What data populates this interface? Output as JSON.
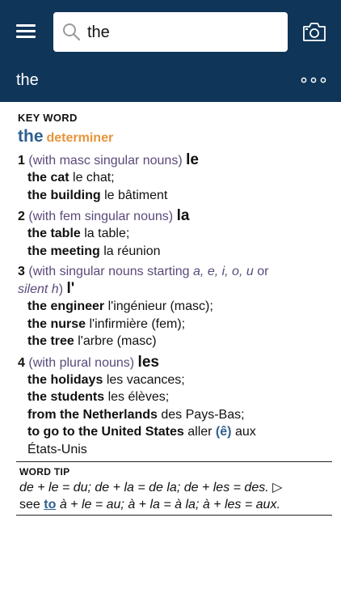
{
  "search": {
    "value": "the"
  },
  "headword_bar": {
    "title": "the"
  },
  "entry": {
    "label": "KEY WORD",
    "headword": "the",
    "pos": "determiner",
    "senses": [
      {
        "num": "1",
        "gloss": "(with masc singular nouns)",
        "translation": "le",
        "examples": [
          {
            "src": "the cat",
            "tgt": "le chat;"
          },
          {
            "src": "the building",
            "tgt": "le bâtiment"
          }
        ]
      },
      {
        "num": "2",
        "gloss": "(with fem singular nouns)",
        "translation": "la",
        "examples": [
          {
            "src": "the table",
            "tgt": "la table;"
          },
          {
            "src": "the meeting",
            "tgt": "la réunion"
          }
        ]
      },
      {
        "num": "3",
        "gloss_start": "(with singular nouns starting",
        "gloss_letters": "a, e, i, o, u",
        "gloss_or": "or",
        "gloss_end_italic": "silent h",
        "gloss_close": ")",
        "translation": "l'",
        "examples": [
          {
            "src": "the engineer",
            "tgt": "l'ingénieur (masc);"
          },
          {
            "src": "the nurse",
            "tgt": "l'infirmière (fem);"
          },
          {
            "src": "the tree",
            "tgt": "l'arbre (masc)"
          }
        ]
      },
      {
        "num": "4",
        "gloss": "(with plural nouns)",
        "translation": "les",
        "examples": [
          {
            "src": "the holidays",
            "tgt": "les vacances;"
          },
          {
            "src": "the students",
            "tgt": "les élèves;"
          },
          {
            "src": "from the Netherlands",
            "tgt": "des Pays-Bas;"
          },
          {
            "src": "to go to the United States",
            "tgt": "aller",
            "link": "(ê)",
            "tgt_after": "aux",
            "tgt_line2": "États-Unis"
          }
        ]
      }
    ]
  },
  "word_tip": {
    "label": "WORD TIP",
    "line1": "de + le = du; de + la = de la; de + les = des.",
    "arrow": "▷",
    "see": "see",
    "link": "to",
    "line2_rest": "à + le = au; à + la = à la; à + les = aux."
  }
}
